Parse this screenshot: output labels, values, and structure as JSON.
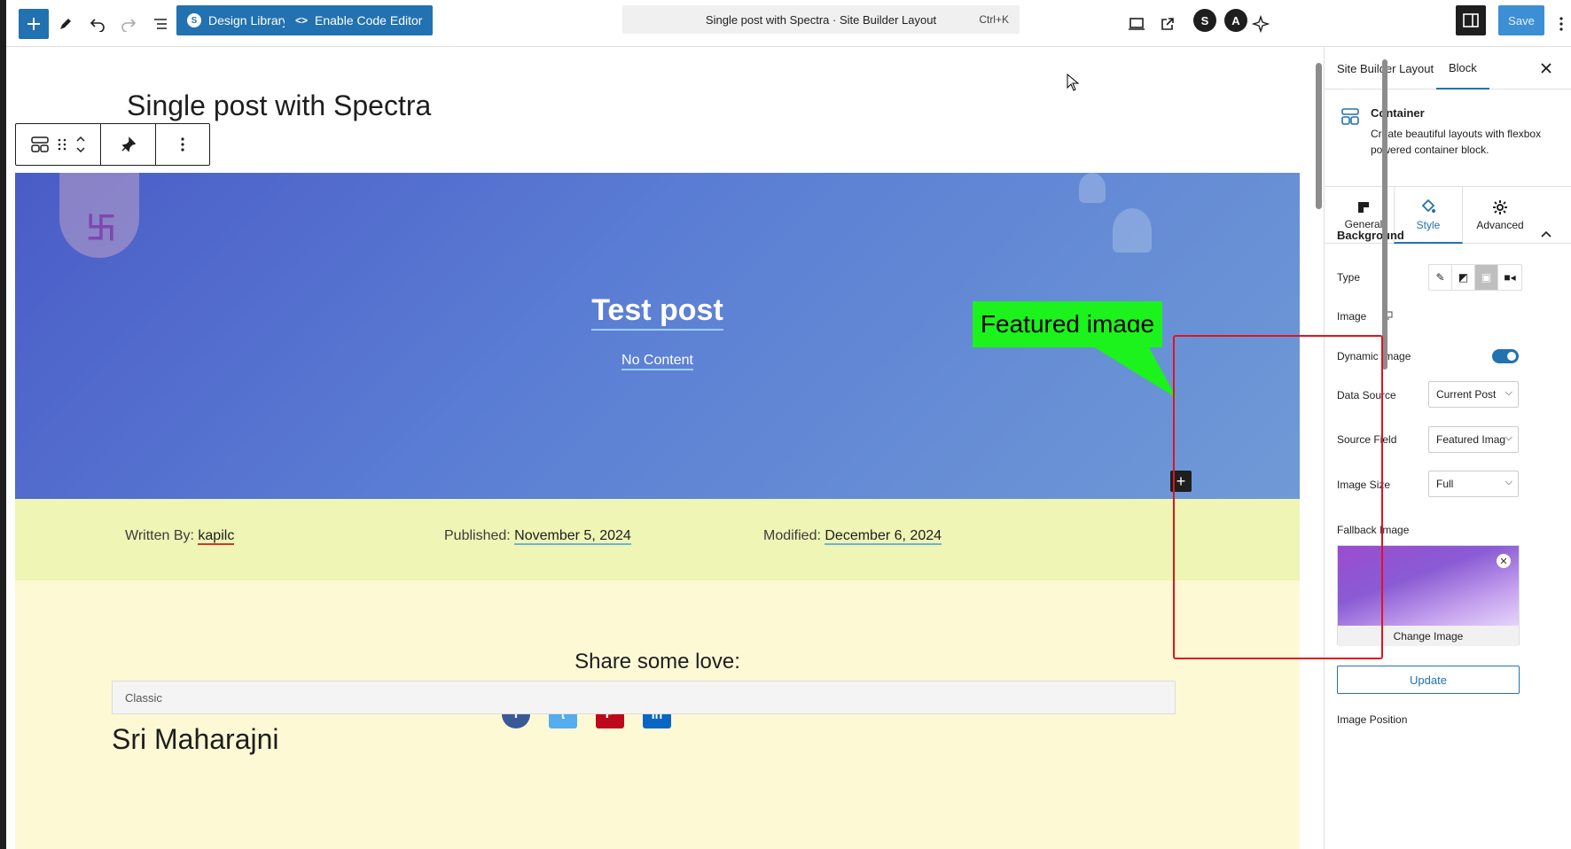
{
  "toolbar": {
    "design_library": "Design Library",
    "code_editor": "Enable Code Editor",
    "command": "Single post with Spectra · Site Builder Layout",
    "shortcut": "Ctrl+K",
    "save": "Save"
  },
  "canvas": {
    "page_title": "Single post with Spectra",
    "hero_title": "Test post",
    "hero_subtitle": "No Content",
    "meta": {
      "written_label": "Written By:",
      "written_value": "kapilc",
      "published_label": "Published:",
      "published_value": "November 5, 2024",
      "modified_label": "Modified:",
      "modified_value": "December 6, 2024"
    },
    "share_title": "Share some love:",
    "social": [
      "facebook-icon",
      "twitter-icon",
      "pinterest-icon",
      "linkedin-icon"
    ],
    "classic_label": "Classic",
    "next_heading": "Sri Maharajni"
  },
  "annotation": {
    "label": "Featured image",
    "color": "#1cf21c",
    "box_color": "#e0141e"
  },
  "sidebar": {
    "tabs": [
      "Site Builder Layout",
      "Block"
    ],
    "block_name": "Container",
    "block_desc": "Create beautiful layouts with flexbox powered container block.",
    "sub_tabs": [
      "General",
      "Style",
      "Advanced"
    ],
    "section": "Background",
    "type_label": "Type",
    "image_label": "Image",
    "dynamic_label": "Dynamic Image",
    "data_source_label": "Data Source",
    "data_source_value": "Current Post",
    "source_field_label": "Source Field",
    "source_field_value": "Featured Imag",
    "image_size_label": "Image Size",
    "image_size_value": "Full",
    "fallback_label": "Fallback Image",
    "change_image": "Change Image",
    "update": "Update",
    "image_position_label": "Image Position"
  },
  "colors": {
    "accent": "#2271b1"
  }
}
